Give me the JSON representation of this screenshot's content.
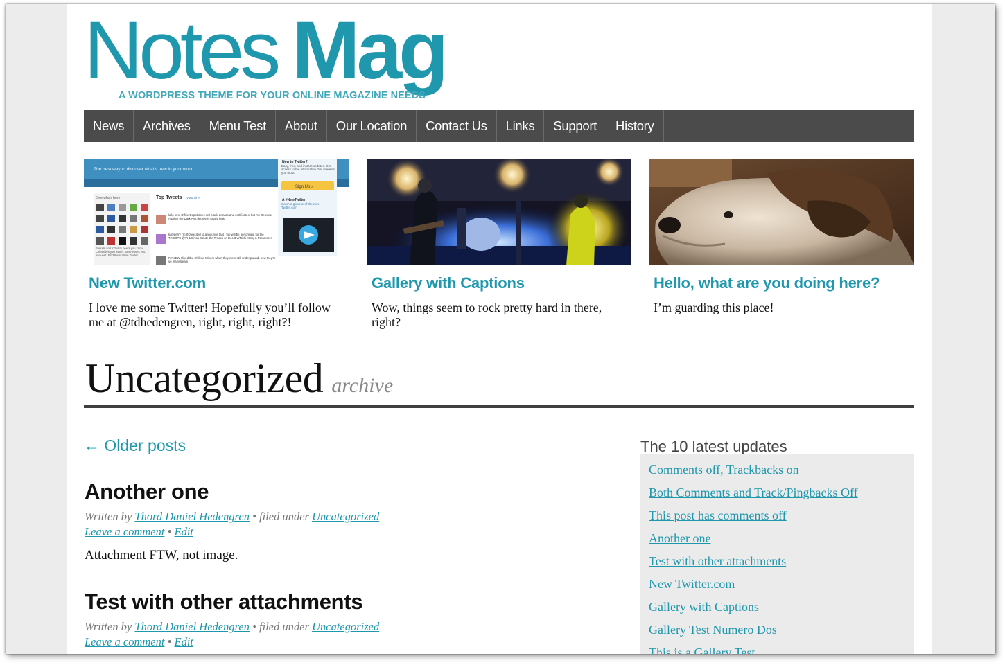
{
  "site": {
    "title_part1": "Notes",
    "title_part2": "Mag",
    "tagline": "A WORDPRESS THEME FOR YOUR ONLINE MAGAZINE NEEDS",
    "accent_color": "#1f97ad",
    "nav_bg": "#4b4b4b"
  },
  "nav": {
    "items": [
      "News",
      "Archives",
      "Menu Test",
      "About",
      "Our Location",
      "Contact Us",
      "Links",
      "Support",
      "History"
    ]
  },
  "featured": [
    {
      "title": "New Twitter.com",
      "excerpt": "I love me some Twitter! Hopefully you’ll follow me at @tdhedengren, right, right, right?!",
      "thumb": {
        "banner": "The best way to discover what’s new in your world.",
        "side_heading": "New to Twitter?",
        "side_text": "Easy, free, and instant updates. Get access to the information that interests you most.",
        "signup": "Sign Up »",
        "new_twitter": "A #NewTwitter",
        "new_twitter_text": "Catch a glimpse of the new Twitter.com",
        "whos_here": "See who's here",
        "top_tweets": "Top Tweets",
        "view_all": "View all »",
        "friends_text": "Friends and industry peers you know. Celebrities you watch. Businesses you frequent. Find them all on Twitter.",
        "tweets": [
          "lallo Yes, Office Depot does sell blank awards and certificates, but my Defense Against the Dark Arts degree is totally legit.",
          "katyperry I'm SO excited to announce that I too will be performing for the TROOPS @VH1 Divas Salute the Troops on Dec 3 w/Nicki Minaj & Paramore!",
          "FATJEW I liked the Chilean Miners when they were still underground, now they're so mainstream"
        ]
      }
    },
    {
      "title": "Gallery with Captions",
      "excerpt": "Wow, things seem to rock pretty hard in there, right?"
    },
    {
      "title": "Hello, what are you doing here?",
      "excerpt": "I’m guarding this place!"
    }
  ],
  "archive": {
    "title": "Uncategorized",
    "subtitle": "archive"
  },
  "older_posts": "← Older posts",
  "posts": [
    {
      "title": "Another one",
      "written_by": "Written by",
      "author": "Thord Daniel Hedengren",
      "filed": " • filed under ",
      "category": "Uncategorized",
      "comment": "Leave a comment",
      "sep": " • ",
      "edit": "Edit",
      "body": "Attachment FTW, not image."
    },
    {
      "title": "Test with other attachments",
      "written_by": "Written by",
      "author": "Thord Daniel Hedengren",
      "filed": " • filed under ",
      "category": "Uncategorized",
      "comment": "Leave a comment",
      "sep": " • ",
      "edit": "Edit"
    }
  ],
  "sidebar": {
    "heading": "The 10 latest updates",
    "links": [
      "Comments off, Trackbacks on",
      "Both Comments and Track/Pingbacks Off",
      "This post has comments off",
      "Another one",
      "Test with other attachments",
      "New Twitter.com",
      "Gallery with Captions",
      "Gallery Test Numero Dos",
      "This is a Gallery Test"
    ]
  }
}
